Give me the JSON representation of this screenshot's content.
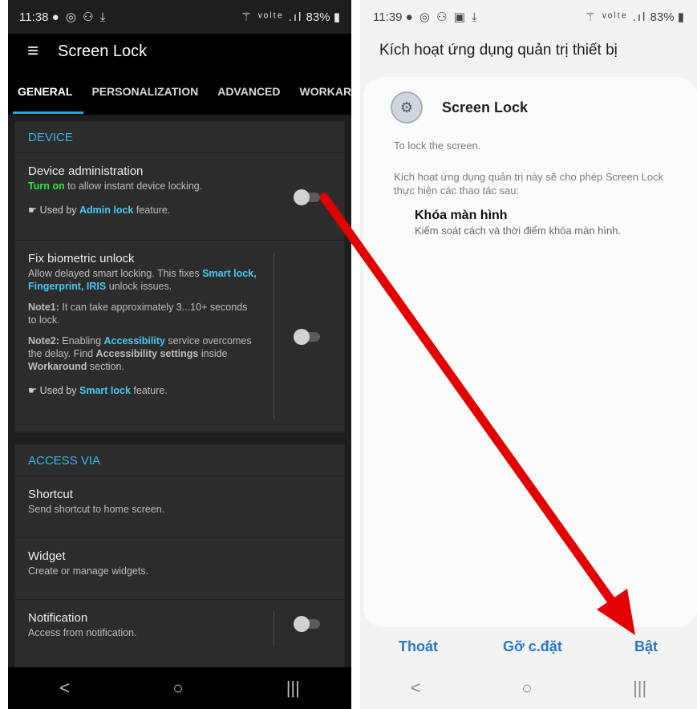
{
  "left": {
    "status": {
      "time": "11:38",
      "left_icons": "● ◎ ⚇ ⤓",
      "right_icons": "⚚ ᵛᵒˡᵗᵉ .ıl",
      "battery": "83% ▮"
    },
    "appbar": {
      "menu_icon": "≡",
      "title": "Screen Lock"
    },
    "tabs": [
      "GENERAL",
      "PERSONALIZATION",
      "ADVANCED",
      "WORKARO"
    ],
    "device": {
      "header": "DEVICE",
      "admin": {
        "title": "Device administration",
        "turn_on": "Turn on",
        "subtitle_rest": " to allow instant device locking.",
        "used_prefix": "☛ Used by ",
        "used_link": "Admin lock",
        "used_suffix": " feature."
      },
      "biometric": {
        "title": "Fix biometric unlock",
        "line1a": "Allow delayed smart locking. This fixes ",
        "line1b": "Smart lock, Fingerprint, IRIS",
        "line1c": " unlock issues.",
        "note1_label": "Note1:",
        "note1_text": " It can take approximately 3...10+ seconds to lock.",
        "note2_label": "Note2:",
        "note2_a": " Enabling ",
        "note2_link": "Accessibility",
        "note2_b": " service overcomes the delay. Find ",
        "note2_bold1": "Accessibility settings",
        "note2_c": " inside ",
        "note2_bold2": "Workaround",
        "note2_d": " section.",
        "used_prefix": "☛ Used by ",
        "used_link": "Smart lock",
        "used_suffix": " feature."
      }
    },
    "access": {
      "header": "ACCESS VIA",
      "shortcut": {
        "title": "Shortcut",
        "subtitle": "Send shortcut to home screen."
      },
      "widget": {
        "title": "Widget",
        "subtitle": "Create or manage widgets."
      },
      "notification": {
        "title": "Notification",
        "subtitle": "Access from notification."
      }
    },
    "nav": {
      "back": "<",
      "home": "○",
      "recents": "|||"
    }
  },
  "right": {
    "status": {
      "time": "11:39",
      "left_icons": "● ◎ ⚇ ▣ ⤓",
      "right_icons": "⚚ ᵛᵒˡᵗᵉ .ıl",
      "battery": "83% ▮"
    },
    "header": "Kích hoạt ứng dụng quản trị thiết bị",
    "app_name": "Screen Lock",
    "description": "To lock the screen.",
    "permission_intro": "Kích hoạt ứng dụng quản trị này sẽ cho phép Screen Lock thực hiện các thao tác sau:",
    "permission_title": "Khóa màn hình",
    "permission_desc": "Kiểm soát cách và thời điểm khóa màn hình.",
    "buttons": {
      "exit": "Thoát",
      "uninstall": "Gỡ c.đặt",
      "enable": "Bật"
    },
    "nav": {
      "back": "<",
      "home": "○",
      "recents": "|||"
    }
  },
  "colors": {
    "accent_blue": "#35b9e6",
    "turn_on_green": "#2ee34a",
    "button_blue": "#2b77c7",
    "arrow_red": "#e30000"
  }
}
